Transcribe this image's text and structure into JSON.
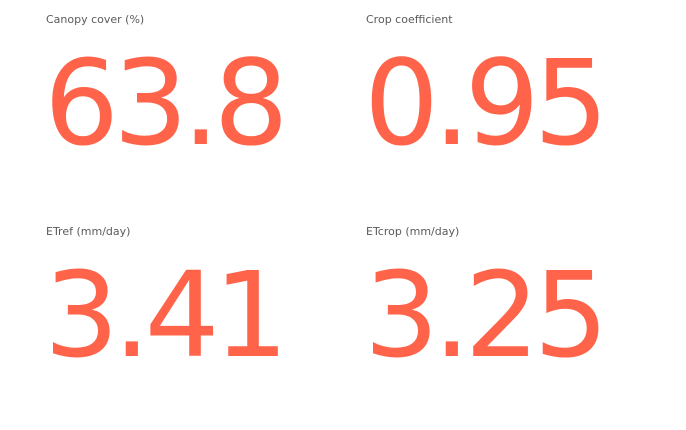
{
  "accent_color": "#ff634a",
  "label_color": "#5a5a5a",
  "cards": [
    {
      "label": "Canopy cover (%)",
      "value": "63.8"
    },
    {
      "label": "Crop coefficient",
      "value": "0.95"
    },
    {
      "label": "ETref (mm/day)",
      "value": "3.41"
    },
    {
      "label": "ETcrop (mm/day)",
      "value": "3.25"
    }
  ]
}
